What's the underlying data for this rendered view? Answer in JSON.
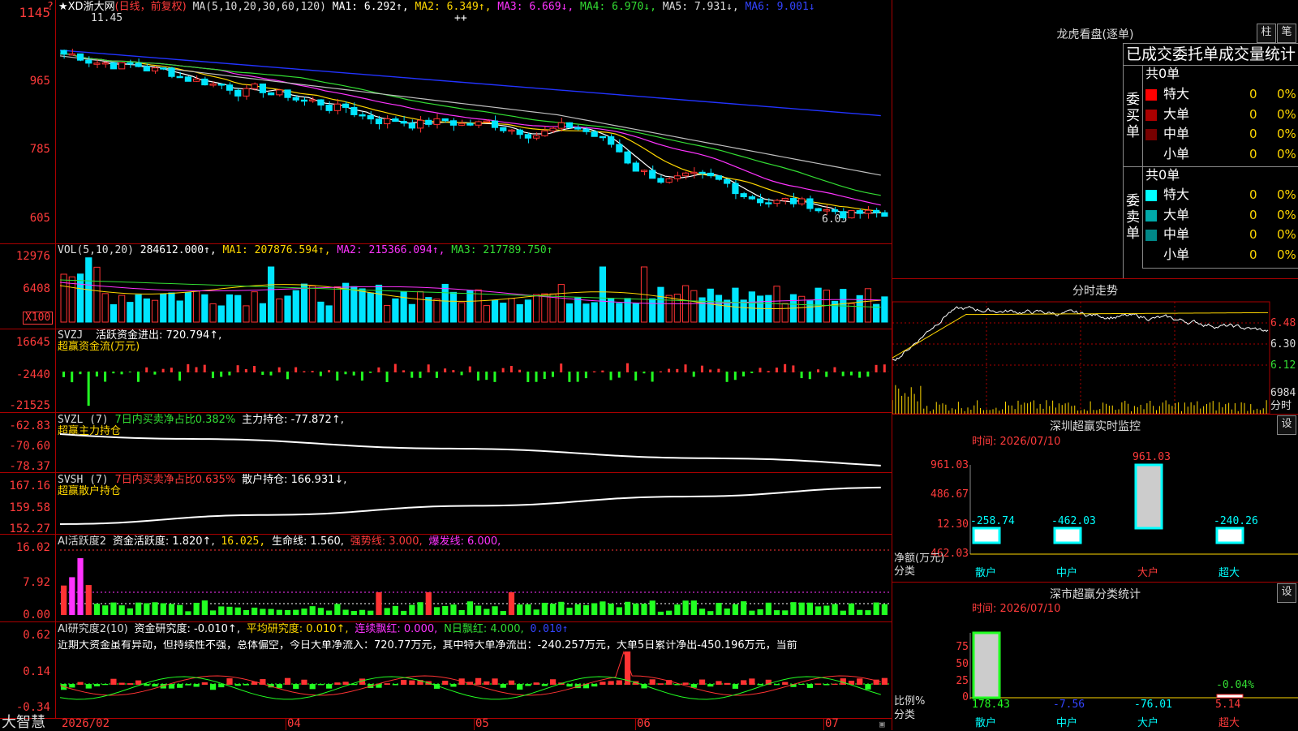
{
  "app": {
    "brand": "大智慧"
  },
  "colors": {
    "up": "#ff3333",
    "down": "#00e5ff",
    "ma1": "#ffffff",
    "ma2": "#ffd700",
    "ma3": "#ff33ff",
    "ma4": "#33dd33",
    "ma5": "#c0c0c0",
    "ma6": "#2233ff",
    "border": "#aa0000"
  },
  "stock": {
    "header_prefix": "★XD浙大网",
    "period": "(日线，前复权)",
    "ma_title": "MA(5,10,20,30,60,120)",
    "ma1": "MA1: 6.292↑,",
    "ma2": "MA2: 6.349↑,",
    "ma3": "MA3: 6.669↓,",
    "ma4": "MA4: 6.970↓,",
    "ma5": "MA5: 7.931↓,",
    "ma6": "MA6: 9.001↓",
    "high_label": "11.45",
    "low_label": "6.05",
    "marker": "++",
    "y_axis": [
      "1145",
      "965",
      "785",
      "605"
    ]
  },
  "vol": {
    "title": "VOL(5,10,20)",
    "value": "284612.000↑,",
    "ma1": "MA1: 207876.594↑,",
    "ma2": "MA2: 215366.094↑,",
    "ma3": "MA3: 217789.750↑",
    "y_axis": [
      "12976",
      "6408"
    ],
    "unit": "X100"
  },
  "svzj": {
    "title": "SVZJ",
    "value": "活跃资金进出: 720.794↑,",
    "subtitle": "超赢资金流(万元)",
    "y_axis": [
      "16645",
      "-2440",
      "-21525"
    ]
  },
  "svzl": {
    "title": "SVZL (7)",
    "ratio": "7日内买卖净占比0.382%",
    "hold": "主力持仓: -77.872↑,",
    "subtitle": "超赢主力持仓",
    "y_axis": [
      "-62.83",
      "-70.60",
      "-78.37"
    ]
  },
  "svsh": {
    "title": "SVSH (7)",
    "ratio": "7日内买卖净占比0.635%",
    "hold": "散户持仓: 166.931↓,",
    "subtitle": "超赢散户持仓",
    "y_axis": [
      "167.16",
      "159.58",
      "152.27"
    ]
  },
  "ai_active": {
    "title": "AI活跃度2",
    "value": "资金活跃度: 1.820↑,",
    "v2": "16.025,",
    "life": "生命线: 1.560,",
    "strong": "强势线: 3.000,",
    "burst": "爆发线: 6.000,",
    "y_axis": [
      "16.02",
      "7.92",
      "0.00"
    ]
  },
  "ai_research": {
    "title": "AI研究度2(10)",
    "value": "资金研究度: -0.010↑,",
    "avg": "平均研究度: 0.010↑,",
    "cont": "连续飘红: 0.000,",
    "nday": "N日飘红: 4.000,",
    "extra": "0.010↑",
    "comment": "近期大资金虽有异动，但持续性不强，总体偏空，今日大单净流入：720.77万元，其中特大单净流出：-240.257万元，大单5日累计净出-450.196万元，当前",
    "y_axis": [
      "0.62",
      "0.14",
      "-0.34"
    ]
  },
  "x_axis": [
    "2026/02",
    "04",
    "05",
    "06",
    "07"
  ],
  "right": {
    "lhb_title": "龙虎看盘(逐单)",
    "btn_zhu": "柱",
    "btn_bi": "笔",
    "order_stats_title": "已成交委托单成交量统计",
    "buy_side": "委买单",
    "sell_side": "委卖单",
    "buy_total": "共0单",
    "sell_total": "共0单",
    "buy_rows": [
      {
        "label": "特大",
        "count": "0",
        "pct": "0%",
        "color": "#ff0000"
      },
      {
        "label": "大单",
        "count": "0",
        "pct": "0%",
        "color": "#aa0000"
      },
      {
        "label": "中单",
        "count": "0",
        "pct": "0%",
        "color": "#770000"
      },
      {
        "label": "小单",
        "count": "0",
        "pct": "0%",
        "color": ""
      }
    ],
    "sell_rows": [
      {
        "label": "特大",
        "count": "0",
        "pct": "0%",
        "color": "#00ffff"
      },
      {
        "label": "大单",
        "count": "0",
        "pct": "0%",
        "color": "#00aaaa"
      },
      {
        "label": "中单",
        "count": "0",
        "pct": "0%",
        "color": "#008888"
      },
      {
        "label": "小单",
        "count": "0",
        "pct": "0%",
        "color": ""
      }
    ],
    "intraday_title": "分时走势",
    "intraday_axis": [
      "6.48",
      "6.30",
      "6.12",
      "6984"
    ],
    "intraday_unit": "分时",
    "sz_monitor_title": "深圳超赢实时监控",
    "btn_set": "设",
    "time_label": "时间: 2026/07/10",
    "net_label": "净额(万元)",
    "class_label": "分类",
    "monitor_axis": [
      "961.03",
      "486.67",
      "12.30",
      "-462.03"
    ],
    "monitor_bars": [
      {
        "cat": "散户",
        "value": "-258.74",
        "num": -258.74
      },
      {
        "cat": "中户",
        "value": "-462.03",
        "num": -462.03
      },
      {
        "cat": "大户",
        "value": "961.03",
        "num": 961.03
      },
      {
        "cat": "超大",
        "value": "-240.26",
        "num": -240.26
      }
    ],
    "sz_class_title": "深市超赢分类统计",
    "ratio_label": "比例%",
    "class_axis": [
      "75",
      "50",
      "25",
      "0"
    ],
    "class_bars": [
      {
        "cat": "散户",
        "value": "178.43",
        "num": 178.43
      },
      {
        "cat": "中户",
        "value": "-7.56",
        "num": -7.56
      },
      {
        "cat": "大户",
        "value": "-76.01",
        "num": -76.01
      },
      {
        "cat": "超大",
        "value": "5.14",
        "num": 5.14
      }
    ],
    "class_top_label": "-0.04%"
  }
}
